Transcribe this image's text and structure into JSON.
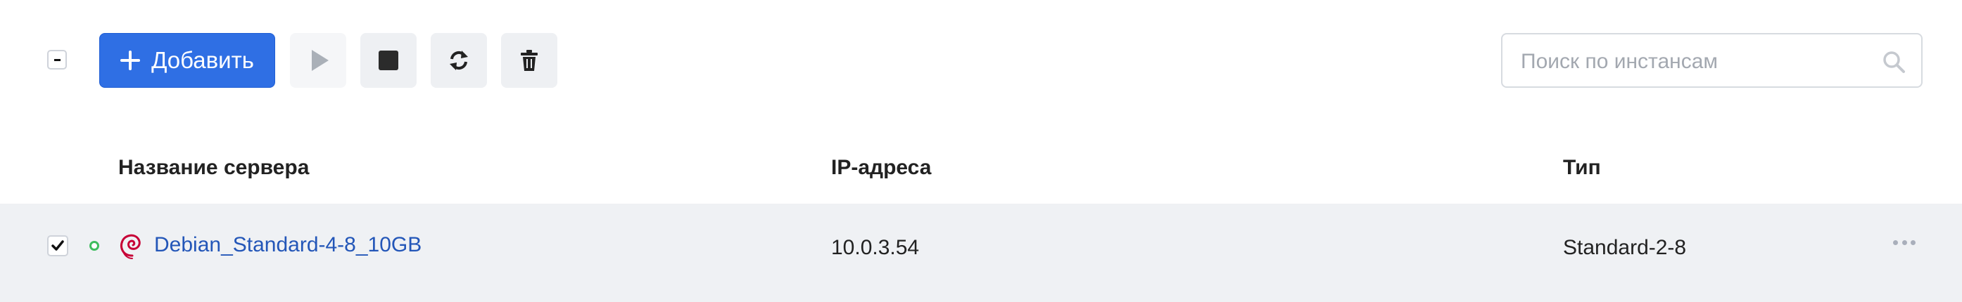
{
  "toolbar": {
    "add_label": "Добавить",
    "search_placeholder": "Поиск по инстансам"
  },
  "table": {
    "columns": [
      "Название сервера",
      "IP-адреса",
      "Тип"
    ],
    "rows": [
      {
        "name": "Debian_Standard-4-8_10GB",
        "ip": "10.0.3.54",
        "type": "Standard-2-8",
        "os_icon": "debian-icon",
        "status": "running",
        "checked": true
      }
    ]
  },
  "colors": {
    "accent": "#2f6fe4",
    "link": "#2356b8",
    "status_ok": "#3ebd5d",
    "row_bg": "#eff1f4",
    "debian": "#c70036"
  }
}
